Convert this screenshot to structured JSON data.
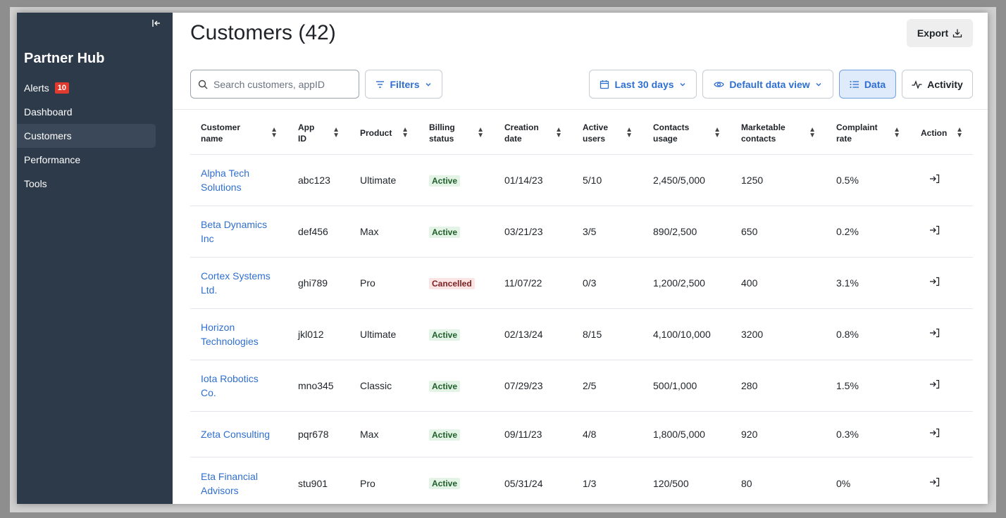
{
  "sidebar": {
    "brand": "Partner Hub",
    "items": [
      {
        "label": "Alerts",
        "badge": "10"
      },
      {
        "label": "Dashboard"
      },
      {
        "label": "Customers"
      },
      {
        "label": "Performance"
      },
      {
        "label": "Tools"
      }
    ],
    "active_item": "Customers",
    "collapse_icon": "collapse-left-icon"
  },
  "header": {
    "title": "Customers (42)",
    "export_label": "Export"
  },
  "toolbar": {
    "search_placeholder": "Search customers, appID",
    "filters_label": "Filters",
    "date_range_label": "Last 30 days",
    "data_view_label": "Default data view",
    "data_label": "Data",
    "activity_label": "Activity",
    "active_view": "Data"
  },
  "table": {
    "columns": [
      "Customer name",
      "App ID",
      "Product",
      "Billing status",
      "Creation date",
      "Active users",
      "Contacts usage",
      "Marketable contacts",
      "Complaint rate",
      "Action"
    ],
    "rows": [
      {
        "name1": "Alpha Tech",
        "name2": "Solutions",
        "app_id": "abc123",
        "product": "Ultimate",
        "status": "Active",
        "created": "01/14/23",
        "users": "5/10",
        "contacts": "2,450/5,000",
        "marketable": "1250",
        "complaint": "0.5%"
      },
      {
        "name1": "Beta Dynamics",
        "name2": "Inc",
        "app_id": "def456",
        "product": "Max",
        "status": "Active",
        "created": "03/21/23",
        "users": "3/5",
        "contacts": "890/2,500",
        "marketable": "650",
        "complaint": "0.2%"
      },
      {
        "name1": "Cortex Systems",
        "name2": "Ltd.",
        "app_id": "ghi789",
        "product": "Pro",
        "status": "Cancelled",
        "created": "11/07/22",
        "users": "0/3",
        "contacts": "1,200/2,500",
        "marketable": "400",
        "complaint": "3.1%"
      },
      {
        "name1": "Horizon",
        "name2": "Technologies",
        "app_id": "jkl012",
        "product": "Ultimate",
        "status": "Active",
        "created": "02/13/24",
        "users": "8/15",
        "contacts": "4,100/10,000",
        "marketable": "3200",
        "complaint": "0.8%"
      },
      {
        "name1": "Iota Robotics",
        "name2": "Co.",
        "app_id": "mno345",
        "product": "Classic",
        "status": "Active",
        "created": "07/29/23",
        "users": "2/5",
        "contacts": "500/1,000",
        "marketable": "280",
        "complaint": "1.5%"
      },
      {
        "name1": "Zeta Consulting",
        "name2": "",
        "app_id": "pqr678",
        "product": "Max",
        "status": "Active",
        "created": "09/11/23",
        "users": "4/8",
        "contacts": "1,800/5,000",
        "marketable": "920",
        "complaint": "0.3%"
      },
      {
        "name1": "Eta Financial",
        "name2": "Advisors",
        "app_id": "stu901",
        "product": "Pro",
        "status": "Active",
        "created": "05/31/24",
        "users": "1/3",
        "contacts": "120/500",
        "marketable": "80",
        "complaint": "0%"
      }
    ]
  },
  "colors": {
    "sidebar_bg": "#2d3a4a",
    "accent": "#2f6fce",
    "badge": "#e03a2e",
    "status_active_bg": "#e3f3e5",
    "status_cancelled_bg": "#fbe4e4"
  }
}
